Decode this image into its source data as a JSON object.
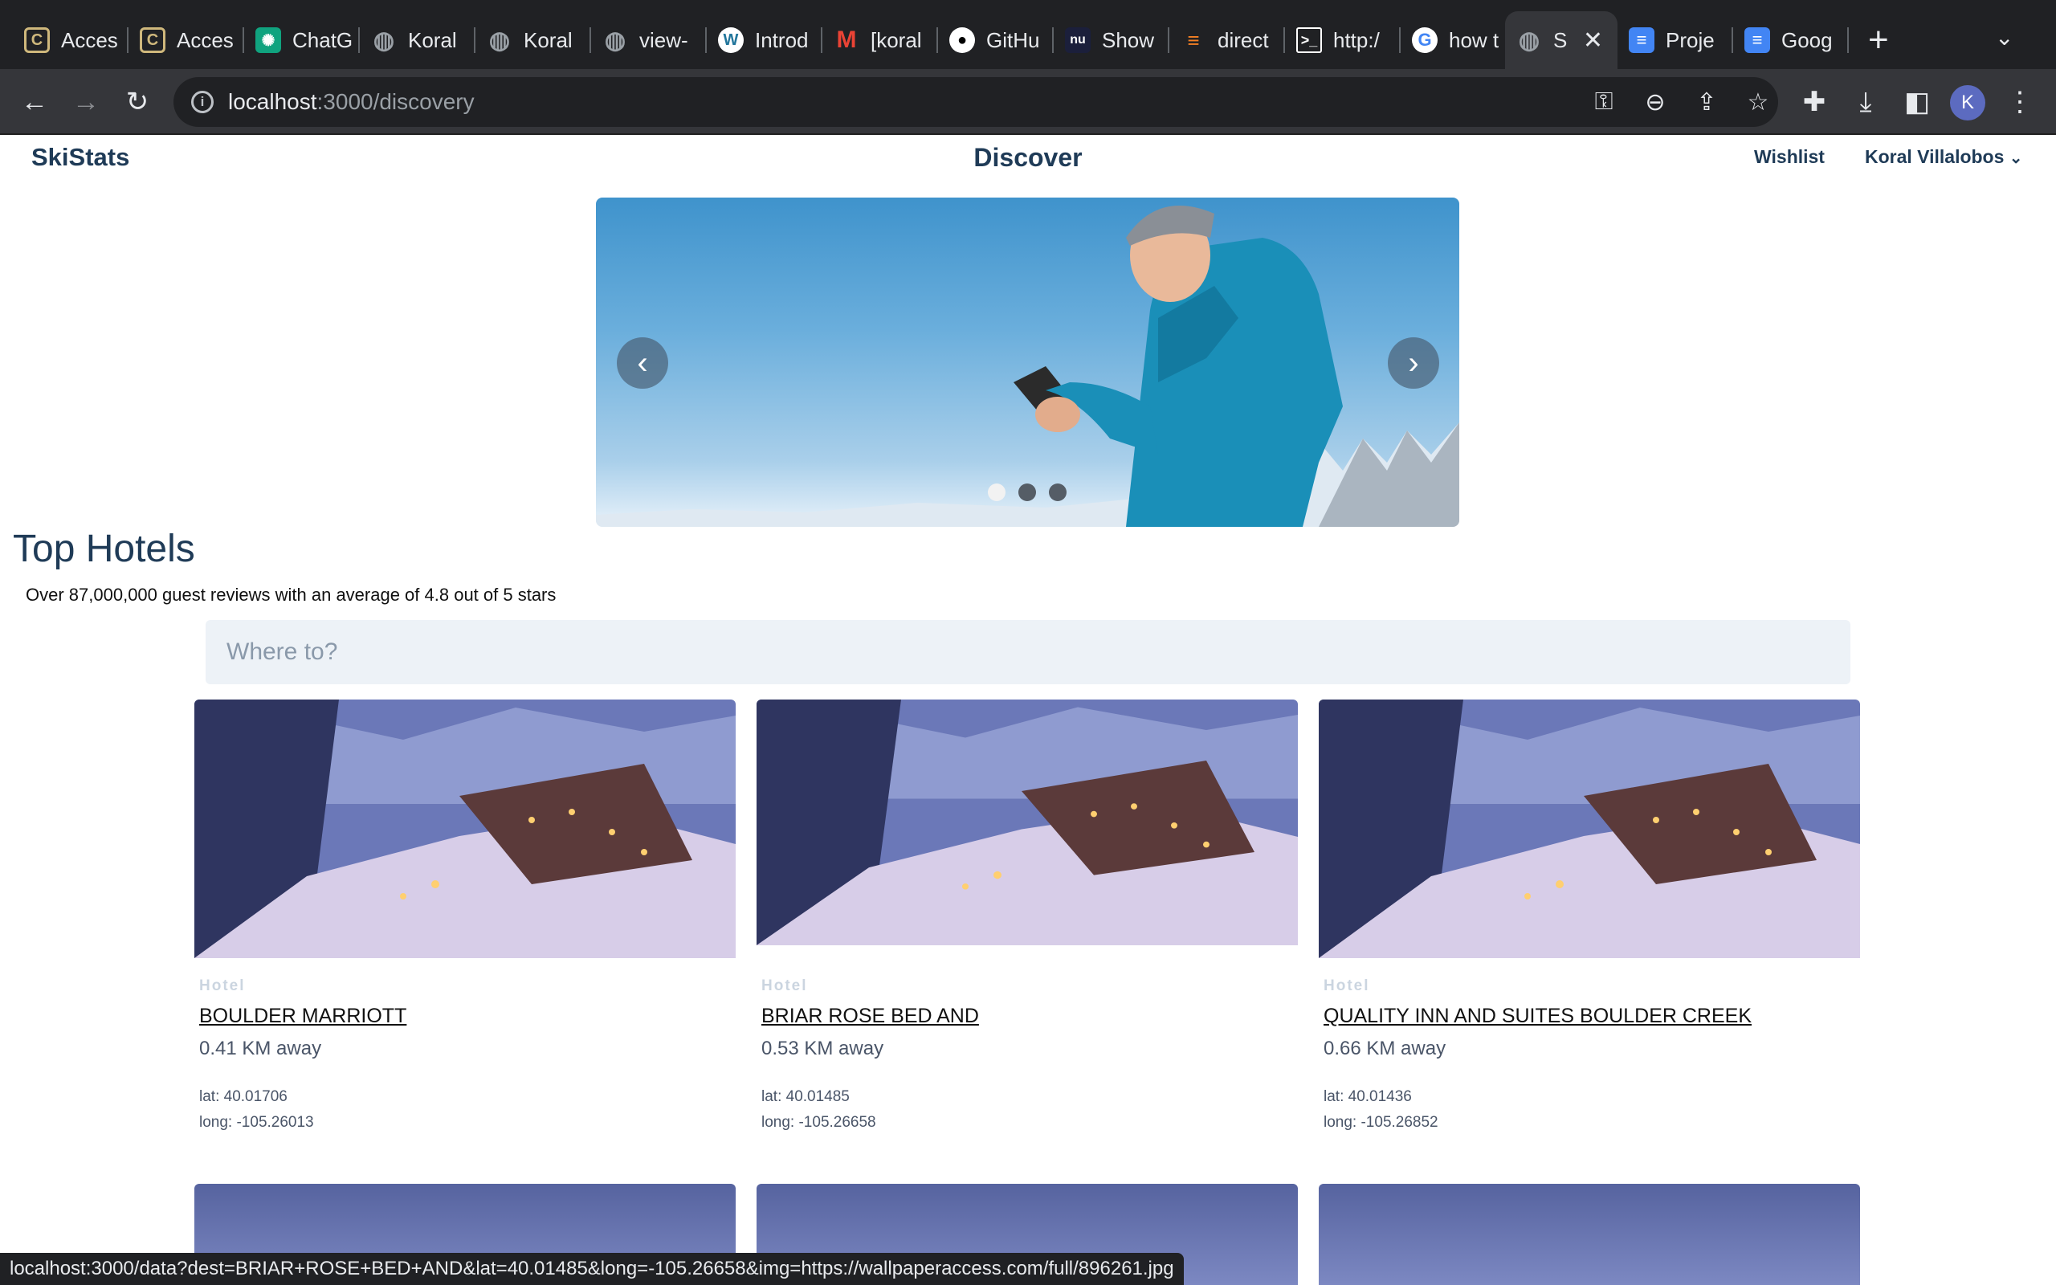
{
  "browser": {
    "tabs": [
      {
        "title": "Acces",
        "icon": "cu-logo-icon"
      },
      {
        "title": "Acces",
        "icon": "cu-logo-icon"
      },
      {
        "title": "ChatG",
        "icon": "openai-icon"
      },
      {
        "title": "Koral",
        "icon": "globe-icon"
      },
      {
        "title": "Koral",
        "icon": "globe-icon"
      },
      {
        "title": "view-",
        "icon": "globe-icon"
      },
      {
        "title": "Introd",
        "icon": "wordpress-icon"
      },
      {
        "title": "[koral",
        "icon": "gmail-icon"
      },
      {
        "title": "GitHu",
        "icon": "github-icon"
      },
      {
        "title": "Show",
        "icon": "nu-icon"
      },
      {
        "title": "direct",
        "icon": "stackoverflow-icon"
      },
      {
        "title": "http:/",
        "icon": "terminal-icon"
      },
      {
        "title": "how t",
        "icon": "google-icon"
      },
      {
        "title": "S",
        "icon": "globe-icon",
        "active": true
      },
      {
        "title": "Proje",
        "icon": "docs-icon"
      },
      {
        "title": "Goog",
        "icon": "docs-icon"
      }
    ],
    "url_host": "localhost",
    "url_path": ":3000/discovery",
    "profile_initial": "K",
    "status_url": "localhost:3000/data?dest=BRIAR+ROSE+BED+AND&lat=40.01485&long=-105.26658&img=https://wallpaperaccess.com/full/896261.jpg"
  },
  "header": {
    "brand": "SkiStats",
    "title": "Discover",
    "wishlist": "Wishlist",
    "user": "Koral Villalobos"
  },
  "carousel": {
    "slide_count": 3,
    "active_slide": 1,
    "prev_icon": "chevron-left-icon",
    "next_icon": "chevron-right-icon"
  },
  "top_hotels": {
    "title": "Top Hotels",
    "subtitle": "Over 87,000,000 guest reviews with an average of 4.8 out of 5 stars",
    "search_placeholder": "Where to?"
  },
  "hotels": [
    {
      "kind": "Hotel",
      "name": "BOULDER MARRIOTT",
      "distance": "0.41 KM away",
      "lat": "lat: 40.01706",
      "long": "long: -105.26013"
    },
    {
      "kind": "Hotel",
      "name": "BRIAR ROSE BED AND",
      "distance": "0.53 KM away",
      "lat": "lat: 40.01485",
      "long": "long: -105.26658"
    },
    {
      "kind": "Hotel",
      "name": "QUALITY INN AND SUITES BOULDER CREEK",
      "distance": "0.66 KM away",
      "lat": "lat: 40.01436",
      "long": "long: -105.26852"
    }
  ],
  "colors": {
    "brand_text": "#1f3b57",
    "search_bg": "#edf2f7"
  }
}
